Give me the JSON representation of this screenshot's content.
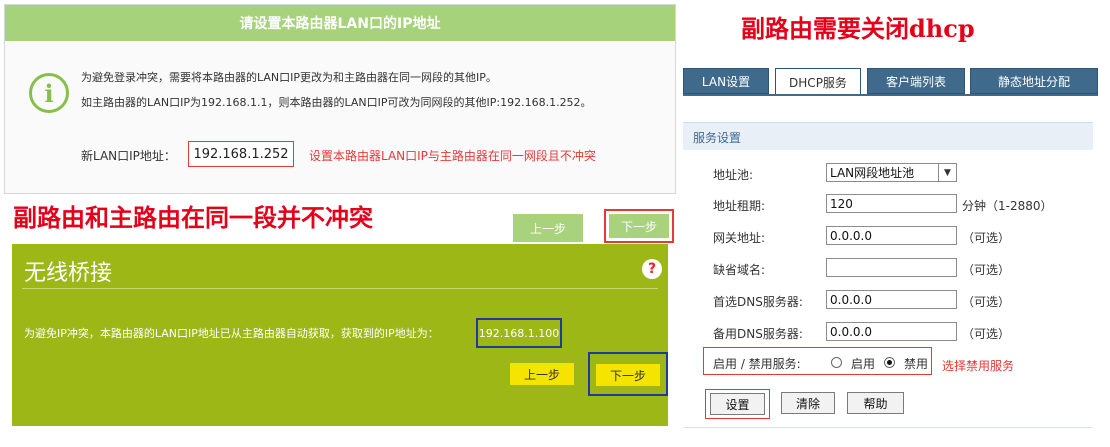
{
  "lan_dialog": {
    "header": "请设置本路由器LAN口的IP地址",
    "line1": "为避免登录冲突，需要将本路由器的LAN口IP更改为和主路由器在同一网段的其他IP。",
    "line2": "如主路由器的LAN口IP为192.168.1.1，则本路由器的LAN口IP可改为同网段的其他IP:192.168.1.252。",
    "new_ip_label": "新LAN口IP地址：",
    "new_ip_value": "192.168.1.252",
    "new_ip_note": "设置本路由器LAN口IP与主路由器在同一网段且不冲突",
    "prev_button": "上一步",
    "next_button": "下一步"
  },
  "captions": {
    "left": "副路由和主路由在同一段并不冲突",
    "right": "副路由需要关闭dhcp"
  },
  "bridge_dialog": {
    "title": "无线桥接",
    "help_icon": "?",
    "message": "为避免IP冲突，本路由器的LAN口IP地址已从主路由器自动获取，获取到的IP地址为：",
    "ip_value": "192.168.1.100",
    "prev_button": "上一步",
    "next_button": "下一步"
  },
  "dhcp": {
    "tabs": [
      {
        "label": "LAN设置",
        "active": false
      },
      {
        "label": "DHCP服务",
        "active": true
      },
      {
        "label": "客户端列表",
        "active": false
      },
      {
        "label": "静态地址分配",
        "active": false
      }
    ],
    "section_title": "服务设置",
    "pool_label": "地址池:",
    "pool_value": "LAN网段地址池",
    "lease_label": "地址租期:",
    "lease_value": "120",
    "lease_unit": "分钟（1-2880）",
    "gateway_label": "网关地址:",
    "gateway_value": "0.0.0.0",
    "gateway_note": "（可选）",
    "domain_label": "缺省域名:",
    "domain_value": "",
    "domain_note": "（可选）",
    "dns1_label": "首选DNS服务器:",
    "dns1_value": "0.0.0.0",
    "dns1_note": "（可选）",
    "dns2_label": "备用DNS服务器:",
    "dns2_value": "0.0.0.0",
    "dns2_note": "（可选）",
    "service_label": "启用 / 禁用服务:",
    "enable_label": "启用",
    "disable_label": "禁用",
    "selected": "disable",
    "disable_note": "选择禁用服务",
    "buttons": {
      "set": "设置",
      "clear": "清除",
      "help": "帮助"
    }
  },
  "colors": {
    "lan_header_green": "#a5d27a",
    "bridge_green": "#9cb716",
    "accent_red": "#e53935",
    "tab_blue": "#3f6a8c",
    "highlight_blue": "#1e3a9e"
  }
}
